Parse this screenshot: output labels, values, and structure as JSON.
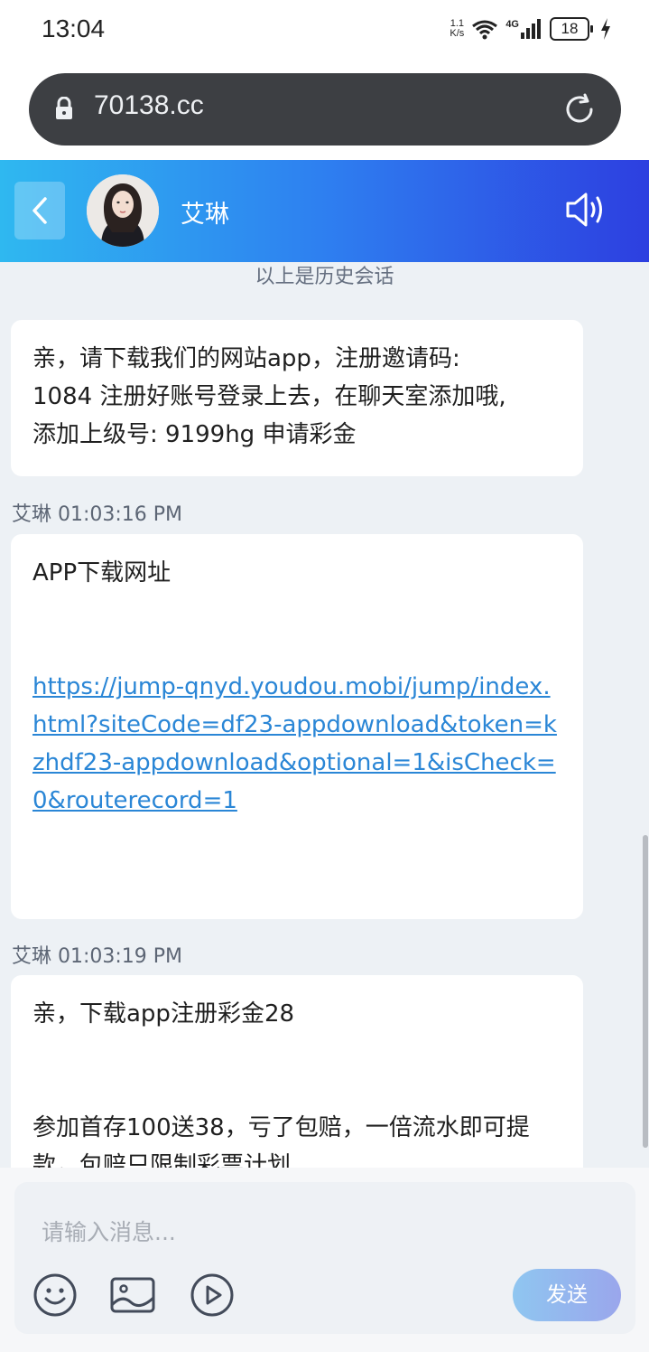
{
  "status_bar": {
    "time": "13:04",
    "net_speed_value": "1.1",
    "net_speed_unit": "K/s",
    "network": "4G",
    "battery": "18"
  },
  "browser": {
    "url": "70138.cc"
  },
  "chat_header": {
    "name": "艾琳"
  },
  "chat": {
    "history_note": "以上是历史会话",
    "messages": [
      {
        "text_lines": [
          "亲，请下载我们的网站app，注册邀请码:",
          "1084  注册好账号登录上去，在聊天室添加哦,",
          "添加上级号:   9199hg 申请彩金"
        ]
      },
      {
        "sender_time": "艾琳 01:03:16 PM",
        "title": "APP下载网址",
        "link": "https://jump-qnyd.youdou.mobi/jump/index.html?siteCode=df23-appdownload&token=kzhdf23-appdownload&optional=1&isCheck=0&routerecord=1"
      },
      {
        "sender_time": "艾琳 01:03:19 PM",
        "title": "亲，下载app注册彩金28",
        "text_lines": [
          "参加首存100送38，亏了包赔，一倍流水即可提",
          "款，包赔只限制彩票计划"
        ]
      }
    ]
  },
  "composer": {
    "placeholder": "请输入消息...",
    "send_label": "发送"
  },
  "colors": {
    "header_gradient_start": "#2fb8f0",
    "header_gradient_end": "#2d3fe0",
    "link": "#2a86d6",
    "chat_background": "#edf1f5"
  }
}
